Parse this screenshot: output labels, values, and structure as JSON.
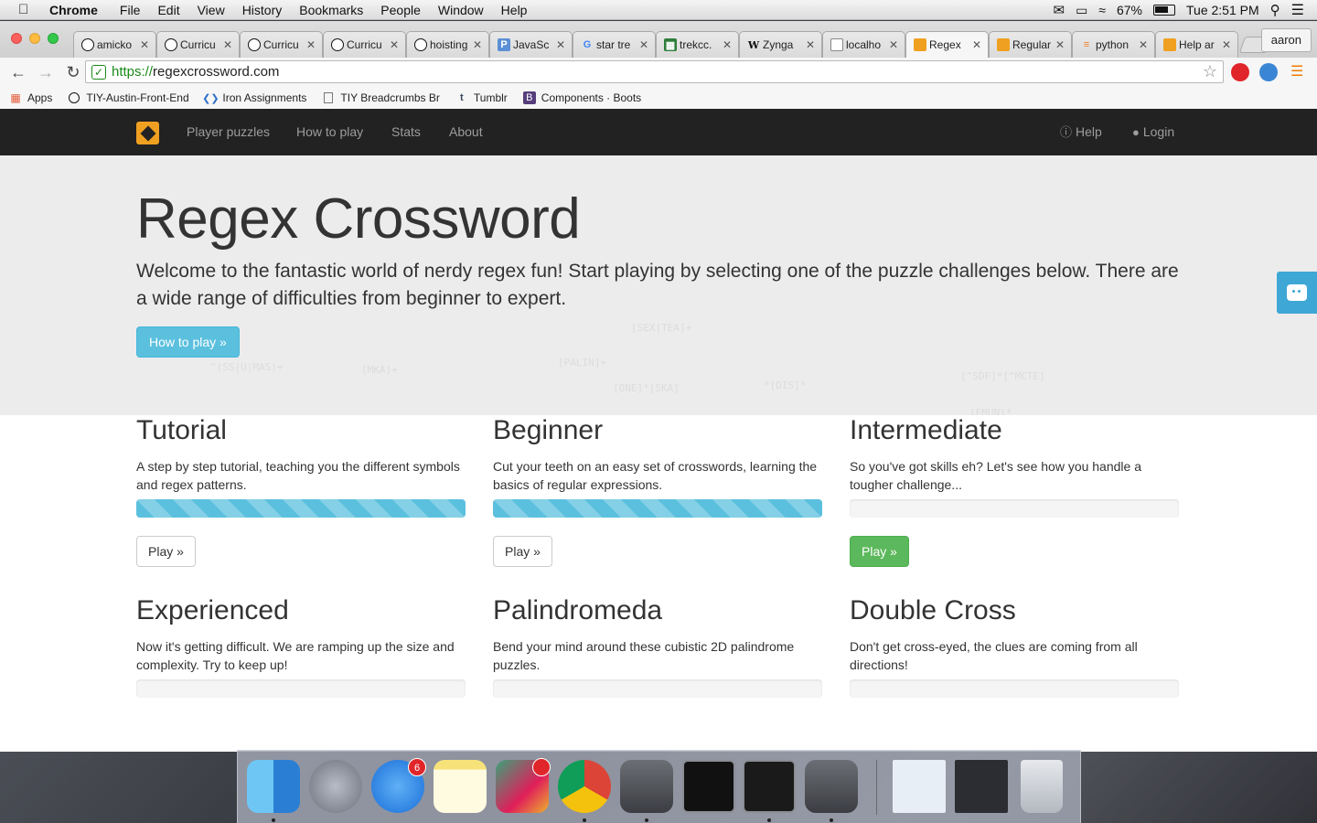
{
  "menubar": {
    "apple_icon": "apple-icon",
    "app_name": "Chrome",
    "items": [
      "File",
      "Edit",
      "View",
      "History",
      "Bookmarks",
      "People",
      "Window",
      "Help"
    ],
    "battery": "67%",
    "clock": "Tue 2:51 PM"
  },
  "browser": {
    "tabs": [
      {
        "label": "amicko",
        "favicon": "github-icon"
      },
      {
        "label": "Curricu",
        "favicon": "github-icon"
      },
      {
        "label": "Curricu",
        "favicon": "github-icon"
      },
      {
        "label": "Curricu",
        "favicon": "github-icon"
      },
      {
        "label": "hoisting",
        "favicon": "github-icon"
      },
      {
        "label": "JavaSc",
        "favicon": "p-icon"
      },
      {
        "label": "star tre",
        "favicon": "google-icon"
      },
      {
        "label": "trekcc.",
        "favicon": "spreadsheet-icon"
      },
      {
        "label": "Zynga",
        "favicon": "wikipedia-icon"
      },
      {
        "label": "localho",
        "favicon": "page-icon"
      },
      {
        "label": "Regex",
        "favicon": "regex-icon",
        "active": true
      },
      {
        "label": "Regular",
        "favicon": "regex-icon"
      },
      {
        "label": "python",
        "favicon": "stackoverflow-icon"
      },
      {
        "label": "Help ar",
        "favicon": "regex-icon"
      }
    ],
    "profile": "aaron",
    "url_scheme": "https://",
    "url_domain": "regexcrossword.com",
    "bookmarks": [
      {
        "label": "Apps",
        "icon": "apps-grid-icon"
      },
      {
        "label": "TIY-Austin-Front-End",
        "icon": "github-icon"
      },
      {
        "label": "Iron Assignments",
        "icon": "blue-arrows-icon"
      },
      {
        "label": "TIY Breadcrumbs Br",
        "icon": "page-icon"
      },
      {
        "label": "Tumblr",
        "icon": "tumblr-icon"
      },
      {
        "label": "Components · Boots",
        "icon": "bootstrap-icon"
      }
    ]
  },
  "site": {
    "nav": [
      "Player puzzles",
      "How to play",
      "Stats",
      "About"
    ],
    "help": "Help",
    "login": "Login",
    "title": "Regex Crossword",
    "intro": "Welcome to the fantastic world of nerdy regex fun! Start playing by selecting one of the puzzle challenges below. There are a wide range of difficulties from beginner to expert.",
    "cta": "How to play »",
    "puzzles": [
      {
        "title": "Tutorial",
        "desc": "A step by step tutorial, teaching you the different symbols and regex patterns.",
        "progress": 1.0,
        "button": "Play »",
        "style": "default"
      },
      {
        "title": "Beginner",
        "desc": "Cut your teeth on an easy set of crosswords, learning the basics of regular expressions.",
        "progress": 1.0,
        "button": "Play »",
        "style": "default"
      },
      {
        "title": "Intermediate",
        "desc": "So you've got skills eh? Let's see how you handle a tougher challenge...",
        "progress": 0.0,
        "button": "Play »",
        "style": "success"
      },
      {
        "title": "Experienced",
        "desc": "Now it's getting difficult. We are ramping up the size and complexity. Try to keep up!",
        "progress": 0.0
      },
      {
        "title": "Palindromeda",
        "desc": "Bend your mind around these cubistic 2D palindrome puzzles.",
        "progress": 0.0
      },
      {
        "title": "Double Cross",
        "desc": "Don't get cross-eyed, the clues are coming from all directions!",
        "progress": 0.0
      }
    ]
  },
  "dock": {
    "apps": [
      "Finder",
      "Launchpad",
      "App Store",
      "Notes",
      "Slack",
      "Chrome",
      "Sublime Text",
      "Terminal",
      "Terminal",
      "Sublime Text"
    ],
    "app_store_badge": "6"
  },
  "colors": {
    "brand": "#f0a020",
    "navbar": "#222222",
    "info": "#5bc0de",
    "success": "#5cb85c"
  }
}
